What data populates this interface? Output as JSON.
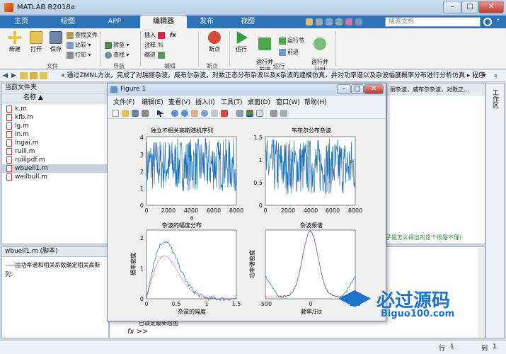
{
  "window": {
    "title": "MATLAB R2018a"
  },
  "tabs": [
    "主页",
    "绘图",
    "APP",
    "编辑器",
    "发布",
    "视图"
  ],
  "search": {
    "placeholder": "搜索文档"
  },
  "ribbon": {
    "new": "新建",
    "open": "打开",
    "save": "保存",
    "find_files": "查找文件",
    "compare": "比较",
    "print": "打印",
    "insert": "插入",
    "fx": "fx",
    "comment": "注释",
    "percent": "%",
    "indent": "缩进",
    "goto": "转至",
    "find": "查找",
    "breakpoints": "断点",
    "run": "运行",
    "run_advance": "运行并\n前进",
    "run_section": "运行节",
    "advance": "前进",
    "run_time": "运行并\n计时",
    "groups": {
      "file": "文件",
      "navigate": "导航",
      "edit": "编辑",
      "breakpoints": "断点",
      "run": "运行"
    }
  },
  "address": {
    "path": "« 通过ZMNL方法，完成了对瑞丽杂波，威布尔杂波，对数正态分布杂波以及K杂波的建模仿真，并对功率谱以及杂波幅度概率分布进行分析仿真 ▸ 程序"
  },
  "current_folder": {
    "title": "当前文件夹",
    "column": "名称 ▲",
    "files": [
      "k.m",
      "kfb.m",
      "lg.m",
      "ln.m",
      "lngai.m",
      "ruili.m",
      "ruilipdf.m",
      "wbuell1.m",
      "weilbull.m"
    ],
    "selected": "wbuell1.m"
  },
  "details": {
    "title": "wbuell1.m (脚本)",
    "text1": "-----由功率谱和相关系数确定相关高斯",
    "text2": "列："
  },
  "editor_snippets": {
    "right_top": "丽杂波，威布尔杂波，对数正...",
    "right_mid": "式子是怎么得出的这个很是不理)"
  },
  "command": {
    "prompt": "fx >>",
    "lock_msg": "已锁定最新绘图"
  },
  "figure": {
    "title": "Figure 1",
    "menu": [
      "文件(F)",
      "编辑(E)",
      "查看(V)",
      "插入(I)",
      "工具(T)",
      "桌面(D)",
      "窗口(W)",
      "帮助(H)"
    ],
    "plots": [
      {
        "title": "独立不相关高斯随机序列",
        "xlabel": "a",
        "ylabel": "",
        "xticks": [
          "0",
          "2000",
          "4000",
          "6000",
          "8000"
        ],
        "yticks": [
          "0",
          "1",
          "2",
          "3",
          "4"
        ]
      },
      {
        "title": "韦布尔分布杂波",
        "xlabel": "",
        "ylabel": "",
        "xticks": [
          "0",
          "2000",
          "4000",
          "6000",
          "8000"
        ],
        "yticks": [
          "0",
          "0.5",
          "1",
          "1.5"
        ]
      },
      {
        "title": "杂波的幅度分布",
        "xlabel": "杂波的幅度",
        "ylabel": "概率密度",
        "xticks": [
          "0",
          "0.5",
          "1",
          "1.5"
        ],
        "yticks": [
          "0",
          "1",
          "2"
        ]
      },
      {
        "title": "杂波频谱",
        "xlabel": "频率/Hz",
        "ylabel": "功率谱密度",
        "xticks": [
          "-500",
          "0",
          "500"
        ],
        "yticks": []
      }
    ]
  },
  "watermark": {
    "brand": "必过源码",
    "site": "Biguo100.com"
  },
  "statusbar": {
    "row_label": "行",
    "row": "1",
    "col_label": "列",
    "col": "1"
  },
  "colors": {
    "tab_bar": "#2b72b6",
    "plot_line": "#1f6fb5",
    "plot_dashed": "#e03030"
  }
}
